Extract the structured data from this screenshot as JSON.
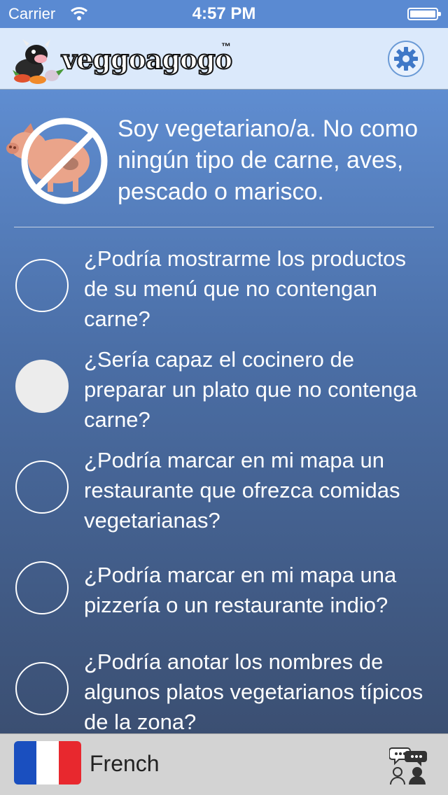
{
  "status_bar": {
    "carrier": "Carrier",
    "time": "4:57 PM"
  },
  "header": {
    "logo_text": "veggoagogo",
    "logo_tm": "™",
    "settings_icon": "gear-icon"
  },
  "intro": {
    "icon": "no-pig-icon",
    "text": "Soy vegetariano/a. No como ningún tipo de carne, aves, pescado o marisco."
  },
  "questions": [
    {
      "text": "¿Podría mostrarme los productos de su menú que no contengan carne?",
      "selected": false
    },
    {
      "text": "¿Sería capaz el cocinero de preparar un plato que no contenga carne?",
      "selected": true
    },
    {
      "text": "¿Podría marcar en mi mapa un restaurante que ofrezca comidas vegetarianas?",
      "selected": false
    },
    {
      "text": "¿Podría marcar en mi mapa una pizzería o un restaurante indio?",
      "selected": false
    },
    {
      "text": "¿Podría anotar los nombres de algunos platos vegetarianos típicos de la zona?",
      "selected": false
    }
  ],
  "tabbar": {
    "language": "French",
    "flag_icon": "french-flag-icon",
    "flag_colors": [
      "#1a4fbf",
      "#ffffff",
      "#e8282e"
    ],
    "chat_icon": "conversation-icon"
  },
  "colors": {
    "accent": "#5a8ad2",
    "header_bg": "#dbe9fb"
  }
}
